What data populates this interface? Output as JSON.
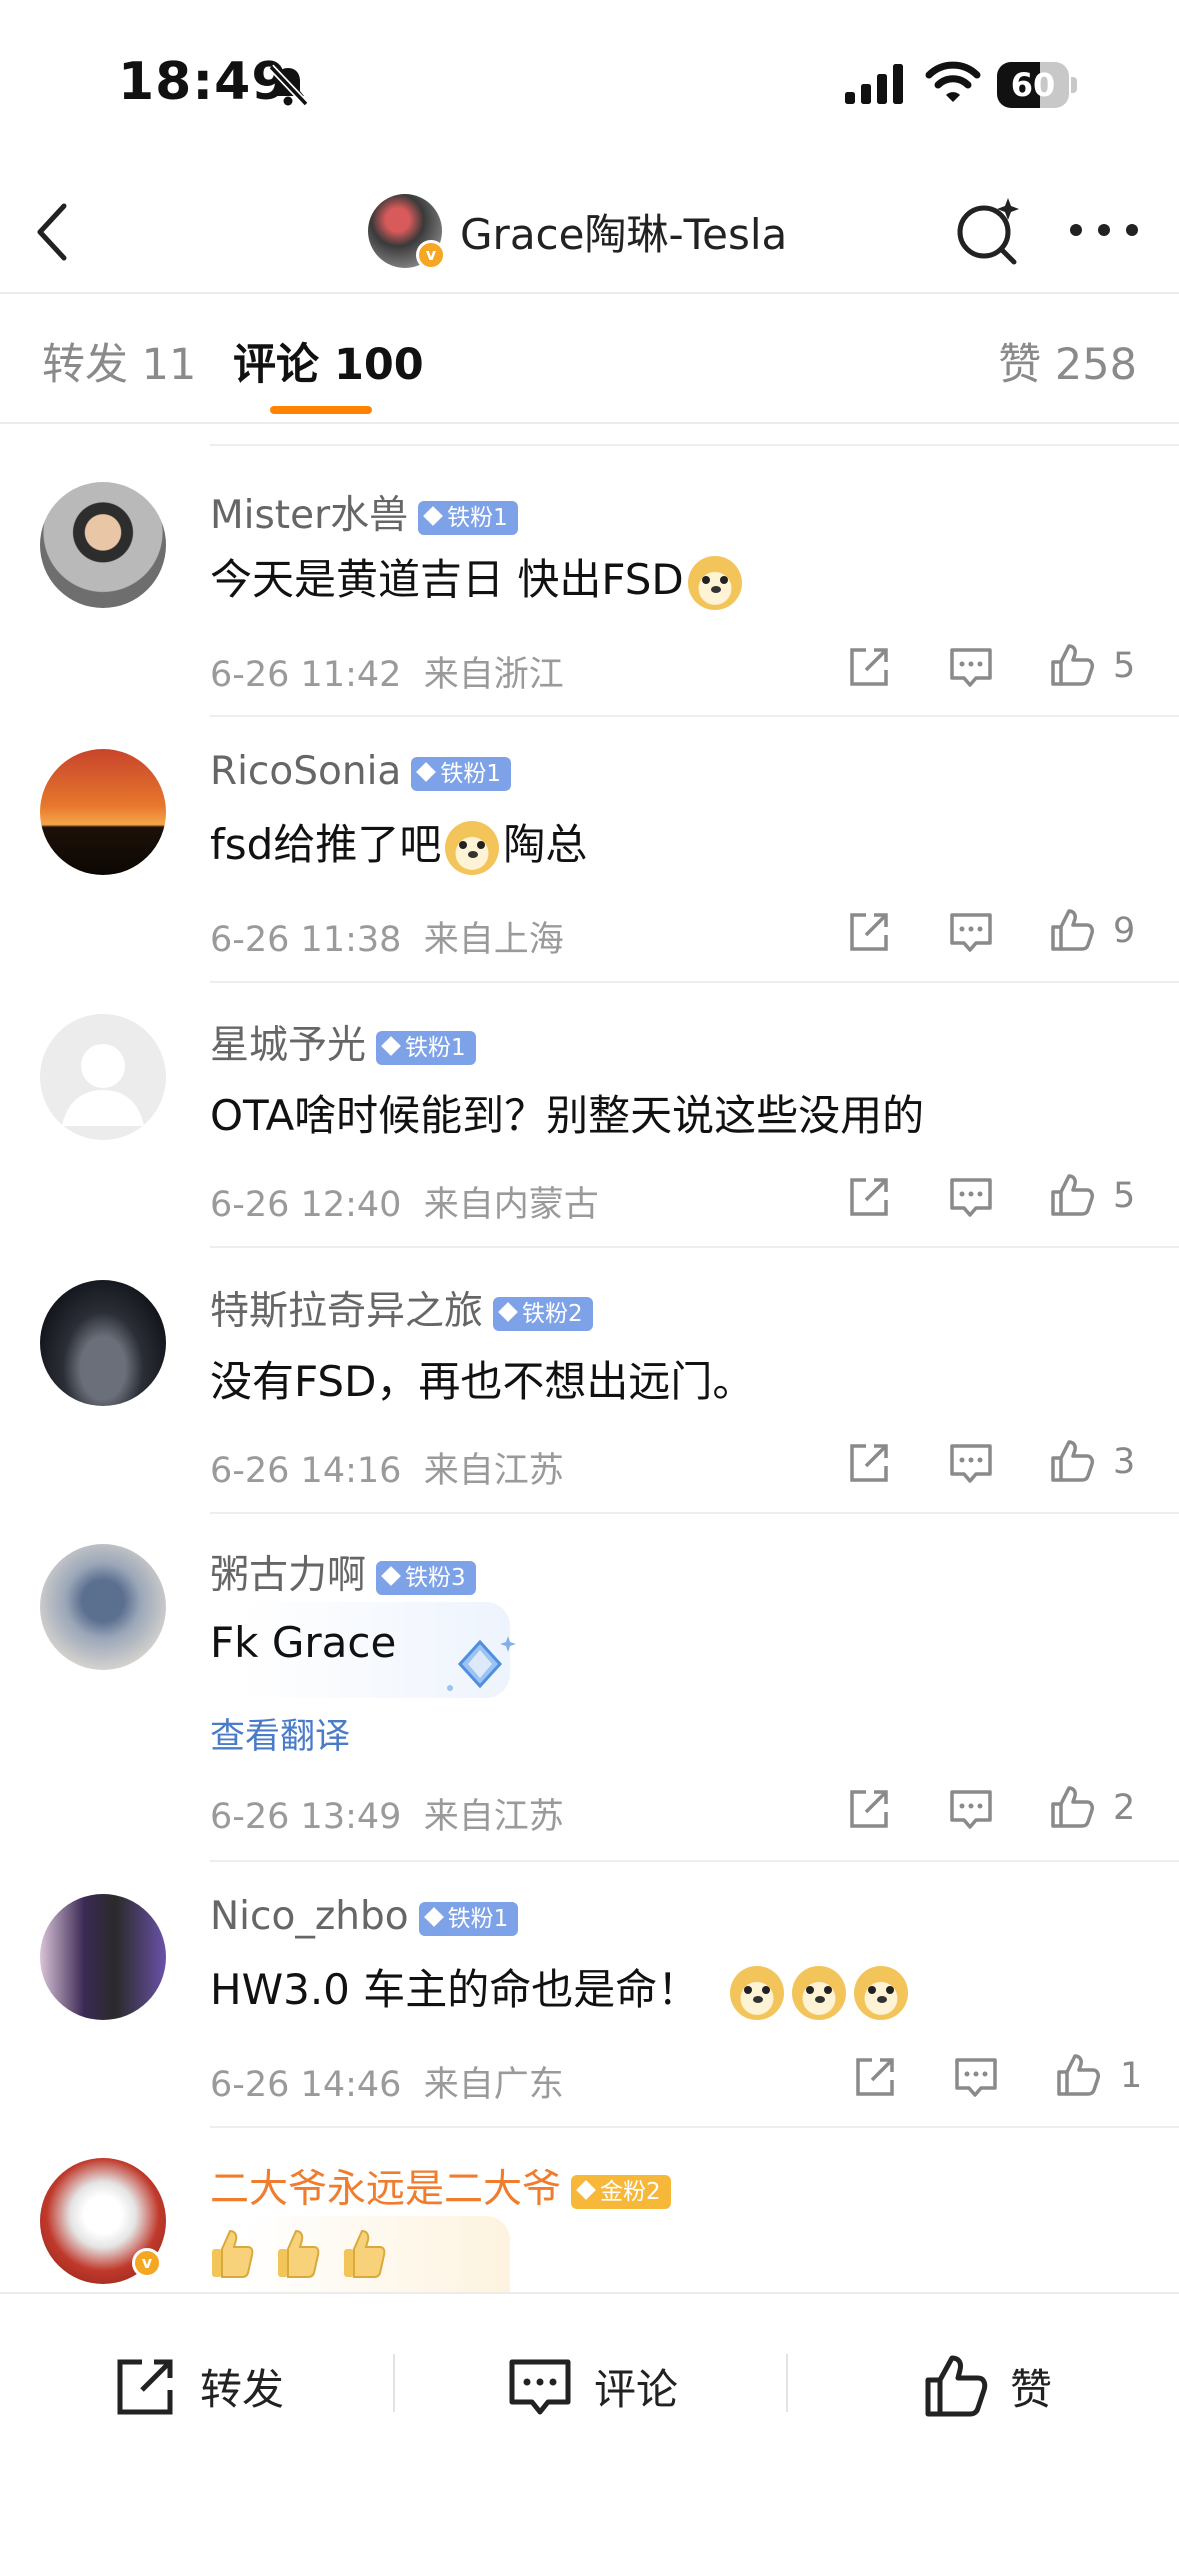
{
  "status_bar": {
    "time": "18:49",
    "battery": "60",
    "battery_level": 0.6
  },
  "nav": {
    "title": "Grace陶琳-Tesla"
  },
  "tabs": {
    "repost": "转发 11",
    "comments": "评论 100",
    "likes": "赞 258"
  },
  "comments": [
    {
      "name": "Mister水兽",
      "badge": "铁粉1",
      "text": "今天是黄道吉日 快出FSD",
      "date": "6-26 11:42",
      "location": "来自浙江",
      "likes": "5"
    },
    {
      "name": "RicoSonia",
      "badge": "铁粉1",
      "text_before": "fsd给推了吧",
      "text_after": "陶总",
      "date": "6-26 11:38",
      "location": "来自上海",
      "likes": "9"
    },
    {
      "name": "星城予光",
      "badge": "铁粉1",
      "text": "OTA啥时候能到？别整天说这些没用的",
      "date": "6-26 12:40",
      "location": "来自内蒙古",
      "likes": "5"
    },
    {
      "name": "特斯拉奇异之旅",
      "badge": "铁粉2",
      "text": "没有FSD，再也不想出远门。",
      "date": "6-26 14:16",
      "location": "来自江苏",
      "likes": "3"
    },
    {
      "name": "粥古力啊",
      "badge": "铁粉3",
      "text": "Fk  Grace",
      "translate": "查看翻译",
      "date": "6-26 13:49",
      "location": "来自江苏",
      "likes": "2"
    },
    {
      "name": "Nico_zhbo",
      "badge": "铁粉1",
      "text": "HW3.0 车主的命也是命！",
      "date": "6-26 14:46",
      "location": "来自广东",
      "likes": "1"
    },
    {
      "name": "二大爷永远是二大爷",
      "badge": "金粉2"
    }
  ],
  "bottom_bar": {
    "repost": "转发",
    "comment": "评论",
    "like": "赞"
  }
}
